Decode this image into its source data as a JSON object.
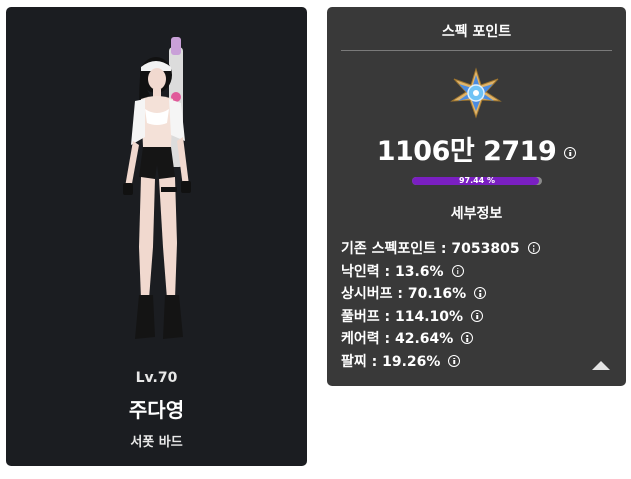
{
  "character": {
    "level": "Lv.70",
    "name": "주다영",
    "class": "서폿 바드"
  },
  "spec": {
    "title": "스펙 포인트",
    "score": "1106만 2719",
    "progress_label": "97.44 %",
    "progress_fraction": 0.9744,
    "detail_heading": "세부정보",
    "rows": [
      {
        "label": "기존 스펙포인트 : 7053805"
      },
      {
        "label": "낙인력 : 13.6%"
      },
      {
        "label": "상시버프 : 70.16%"
      },
      {
        "label": "풀버프 : 114.10%"
      },
      {
        "label": "케어력 : 42.64%"
      },
      {
        "label": "팔찌 : 19.26%"
      }
    ]
  },
  "colors": {
    "card_dark": "#1b1d21",
    "card_gray": "#393939",
    "progress_fill": "#7a1fc2",
    "progress_track": "#8a8a8a"
  },
  "icons": [
    "info-icon",
    "emblem-icon",
    "collapse-arrow-icon"
  ]
}
